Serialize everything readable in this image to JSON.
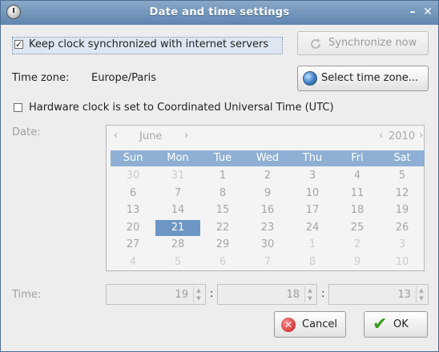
{
  "window": {
    "title": "Date and time settings"
  },
  "sync": {
    "checkbox_label": "Keep clock synchronized with internet servers",
    "checked": true,
    "sync_button": "Synchronize now"
  },
  "timezone": {
    "label": "Time zone:",
    "value": "Europe/Paris",
    "select_button": "Select time zone..."
  },
  "hwclock": {
    "label": "Hardware clock is set to Coordinated Universal Time (UTC)",
    "checked": false
  },
  "date": {
    "label": "Date:",
    "month": "June",
    "year": "2010",
    "weekdays": [
      "Sun",
      "Mon",
      "Tue",
      "Wed",
      "Thu",
      "Fri",
      "Sat"
    ],
    "weeks": [
      [
        "30",
        "31",
        "1",
        "2",
        "3",
        "4",
        "5"
      ],
      [
        "6",
        "7",
        "8",
        "9",
        "10",
        "11",
        "12"
      ],
      [
        "13",
        "14",
        "15",
        "16",
        "17",
        "18",
        "19"
      ],
      [
        "20",
        "21",
        "22",
        "23",
        "24",
        "25",
        "26"
      ],
      [
        "27",
        "28",
        "29",
        "30",
        "1",
        "2",
        "3"
      ],
      [
        "4",
        "5",
        "6",
        "7",
        "8",
        "9",
        "10"
      ]
    ],
    "selected_day": "21"
  },
  "time": {
    "label": "Time:",
    "hour": "19",
    "minute": "18",
    "second": "13",
    "separator": ":"
  },
  "buttons": {
    "cancel": "Cancel",
    "ok": "OK"
  },
  "colors": {
    "title_bar": "#6d8fb6",
    "selected_day": "#6d96c6",
    "weekday_header": "#8fb0d4"
  }
}
